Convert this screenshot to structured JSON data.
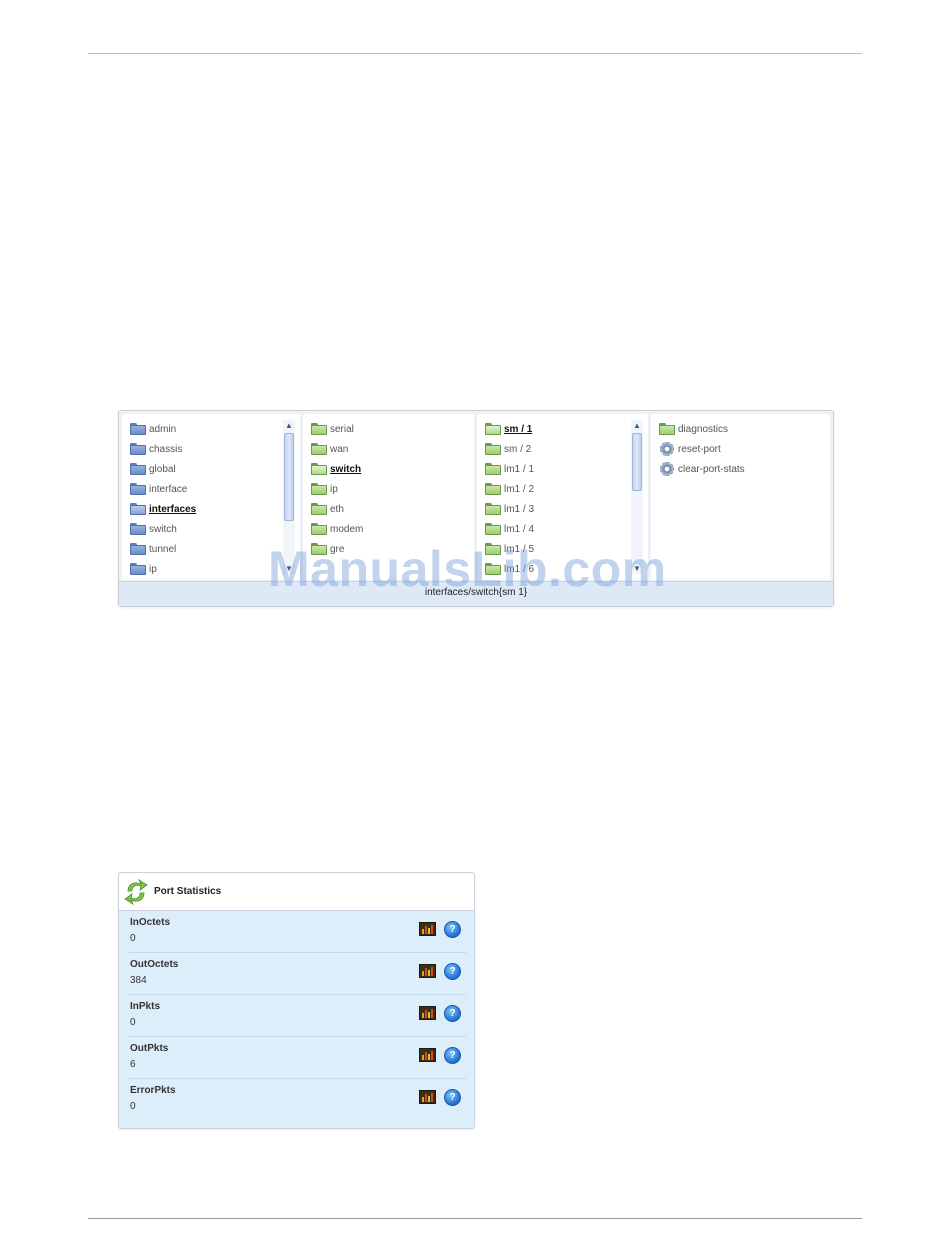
{
  "browser": {
    "columns": [
      {
        "items": [
          {
            "label": "admin",
            "color": "blue"
          },
          {
            "label": "chassis",
            "color": "blue"
          },
          {
            "label": "global",
            "color": "blue"
          },
          {
            "label": "interface",
            "color": "blue"
          },
          {
            "label": "interfaces",
            "color": "blue",
            "selected": true
          },
          {
            "label": "switch",
            "color": "blue"
          },
          {
            "label": "tunnel",
            "color": "blue"
          },
          {
            "label": "ip",
            "color": "blue"
          }
        ]
      },
      {
        "items": [
          {
            "label": "serial",
            "color": "green"
          },
          {
            "label": "wan",
            "color": "green"
          },
          {
            "label": "switch",
            "color": "green",
            "selected": true
          },
          {
            "label": "ip",
            "color": "green"
          },
          {
            "label": "eth",
            "color": "green"
          },
          {
            "label": "modem",
            "color": "green"
          },
          {
            "label": "gre",
            "color": "green"
          }
        ]
      },
      {
        "items": [
          {
            "label": "sm / 1",
            "color": "green",
            "selected": true
          },
          {
            "label": "sm / 2",
            "color": "green"
          },
          {
            "label": "lm1 / 1",
            "color": "green"
          },
          {
            "label": "lm1 / 2",
            "color": "green"
          },
          {
            "label": "lm1 / 3",
            "color": "green"
          },
          {
            "label": "lm1 / 4",
            "color": "green"
          },
          {
            "label": "lm1 / 5",
            "color": "green"
          },
          {
            "label": "lm1 / 6",
            "color": "green"
          }
        ]
      },
      {
        "items": [
          {
            "label": "diagnostics",
            "icon": "folder-icon",
            "color": "green"
          },
          {
            "label": "reset-port",
            "icon": "gear-icon"
          },
          {
            "label": "clear-port-stats",
            "icon": "gear-icon"
          }
        ]
      }
    ],
    "path": "interfaces/switch{sm 1}"
  },
  "watermark": "ManualsLib.com",
  "port_stats": {
    "title": "Port Statistics",
    "stats": [
      {
        "name": "InOctets",
        "value": "0"
      },
      {
        "name": "OutOctets",
        "value": "384"
      },
      {
        "name": "InPkts",
        "value": "0"
      },
      {
        "name": "OutPkts",
        "value": "6"
      },
      {
        "name": "ErrorPkts",
        "value": "0"
      }
    ],
    "help_glyph": "?"
  }
}
